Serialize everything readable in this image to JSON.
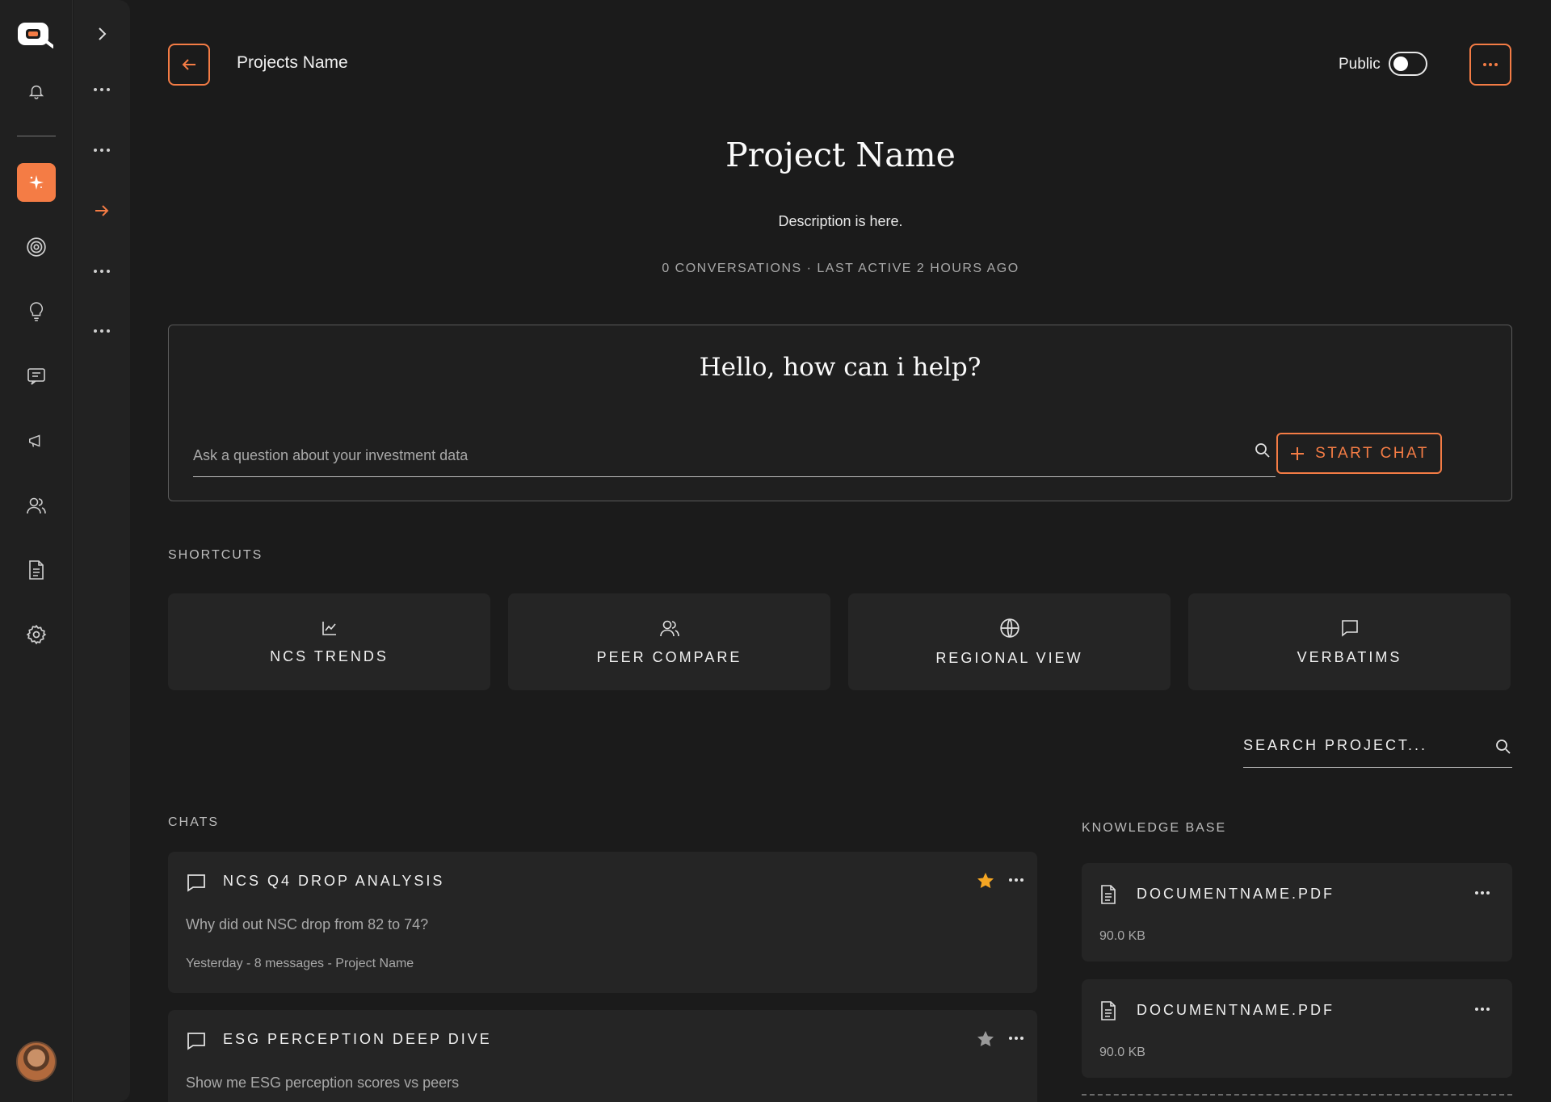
{
  "app": {
    "icons": [
      "logo-icon",
      "bell-icon",
      "sparkle-icon",
      "target-icon",
      "lightbulb-icon",
      "message-icon",
      "megaphone-icon",
      "users-icon",
      "document-icon",
      "settings-icon"
    ]
  },
  "header": {
    "breadcrumb": "Projects Name",
    "public_label": "Public",
    "public_toggle_on": false
  },
  "project": {
    "title": "Project Name",
    "description": "Description is here.",
    "meta": "0 CONVERSATIONS · LAST ACTIVE 2 HOURS AGO"
  },
  "chatbox": {
    "greeting": "Hello, how can i help?",
    "placeholder": "Ask a question about your investment data",
    "start_label": "START CHAT"
  },
  "shortcuts": {
    "heading": "SHORTCUTS",
    "items": [
      {
        "label": "NCS TRENDS",
        "icon": "chart-icon"
      },
      {
        "label": "PEER COMPARE",
        "icon": "users-icon"
      },
      {
        "label": "REGIONAL VIEW",
        "icon": "globe-icon"
      },
      {
        "label": "VERBATIMS",
        "icon": "message-icon"
      }
    ]
  },
  "search": {
    "placeholder": "SEARCH PROJECT..."
  },
  "chats": {
    "heading": "CHATS",
    "items": [
      {
        "title": "NCS Q4 DROP ANALYSIS",
        "question": "Why did out NSC drop from 82 to 74?",
        "meta": "Yesterday - 8 messages  - Project Name",
        "starred": true
      },
      {
        "title": "ESG PERCEPTION DEEP DIVE",
        "question": "Show me ESG perception scores vs peers",
        "meta": "",
        "starred": false
      }
    ]
  },
  "knowledge_base": {
    "heading": "KNOWLEDGE BASE",
    "items": [
      {
        "name": "DOCUMENTNAME.PDF",
        "size": "90.0 KB"
      },
      {
        "name": "DOCUMENTNAME.PDF",
        "size": "90.0 KB"
      }
    ]
  },
  "colors": {
    "accent": "#f47c45",
    "star_active": "#f5a623",
    "star_inactive": "#9a9a9a",
    "background": "#1b1b1b",
    "card": "#252525"
  }
}
